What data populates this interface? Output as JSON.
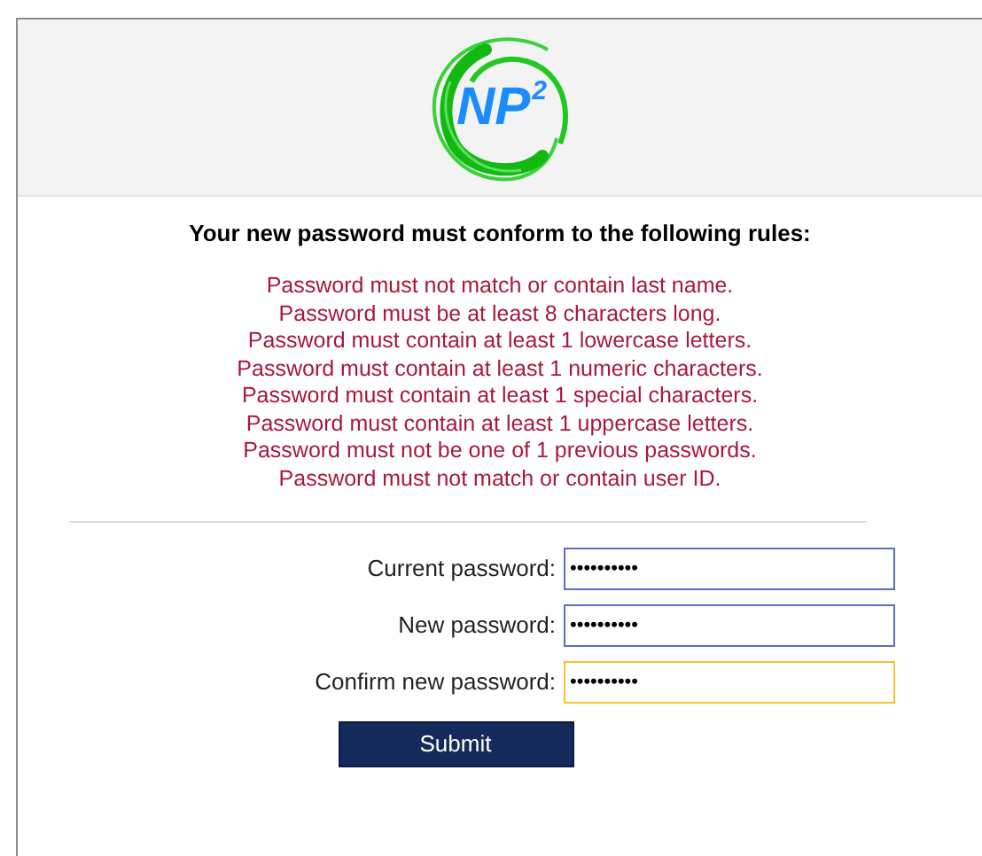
{
  "logo": {
    "text": "NP",
    "superscript": "2"
  },
  "rules_heading": "Your new password must conform to the following rules:",
  "rules": [
    "Password must not match or contain last name.",
    "Password must be at least 8 characters long.",
    "Password must contain at least 1 lowercase letters.",
    "Password must contain at least 1 numeric characters.",
    "Password must contain at least 1 special characters.",
    "Password must contain at least 1 uppercase letters.",
    "Password must not be one of 1 previous passwords.",
    "Password must not match or contain user ID."
  ],
  "fields": [
    {
      "label": "Current password:",
      "value": "••••••••••",
      "focused": false
    },
    {
      "label": "New password:",
      "value": "••••••••••",
      "focused": false
    },
    {
      "label": "Confirm new password:",
      "value": "••••••••••",
      "focused": true
    }
  ],
  "submit": "Submit"
}
